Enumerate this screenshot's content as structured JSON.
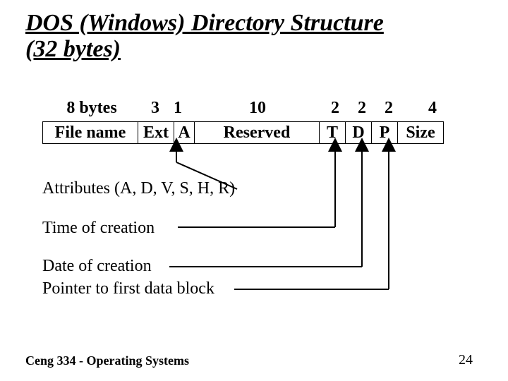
{
  "title_line1": "DOS (Windows) Directory Structure",
  "title_line2": "(32 bytes)",
  "bytes": {
    "c0": "8 bytes",
    "c1": "3",
    "c2": "1",
    "c3": "10",
    "c4": "2",
    "c5": "2",
    "c6": "2",
    "c7": "4"
  },
  "cells": {
    "c0": "File name",
    "c1": "Ext",
    "c2": "A",
    "c3": "Reserved",
    "c4": "T",
    "c5": "D",
    "c6": "P",
    "c7": "Size"
  },
  "labels": {
    "attrs": "Attributes (A, D, V, S, H, R)",
    "time": "Time of creation",
    "date": "Date of creation",
    "ptr": "Pointer to first data block"
  },
  "footer": {
    "course": "Ceng 334 - Operating Systems",
    "page": "24"
  },
  "chart_data": {
    "type": "table",
    "title": "DOS (Windows) Directory Structure (32 bytes)",
    "fields": [
      {
        "name": "File name",
        "bytes": 8
      },
      {
        "name": "Ext",
        "bytes": 3
      },
      {
        "name": "A",
        "bytes": 1,
        "description": "Attributes (A, D, V, S, H, R)"
      },
      {
        "name": "Reserved",
        "bytes": 10
      },
      {
        "name": "T",
        "bytes": 2,
        "description": "Time of creation"
      },
      {
        "name": "D",
        "bytes": 2,
        "description": "Date of creation"
      },
      {
        "name": "P",
        "bytes": 2,
        "description": "Pointer to first data block"
      },
      {
        "name": "Size",
        "bytes": 4
      }
    ],
    "total_bytes": 32
  }
}
